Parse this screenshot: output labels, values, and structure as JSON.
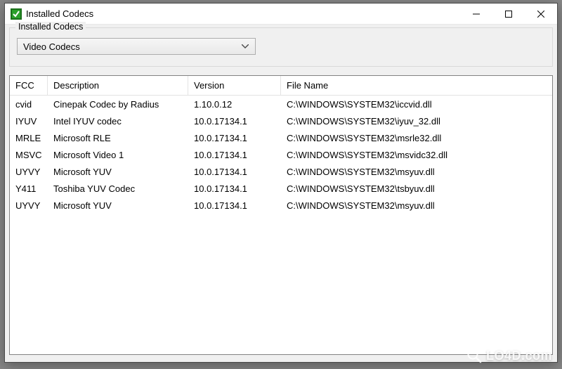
{
  "window": {
    "title": "Installed Codecs"
  },
  "group": {
    "label": "Installed Codecs",
    "dropdown_value": "Video Codecs"
  },
  "columns": {
    "fcc": "FCC",
    "description": "Description",
    "version": "Version",
    "filename": "File Name"
  },
  "rows": [
    {
      "fcc": "cvid",
      "desc": "Cinepak Codec by Radius",
      "ver": "1.10.0.12",
      "file": "C:\\WINDOWS\\SYSTEM32\\iccvid.dll"
    },
    {
      "fcc": "IYUV",
      "desc": "Intel IYUV codec",
      "ver": "10.0.17134.1",
      "file": "C:\\WINDOWS\\SYSTEM32\\iyuv_32.dll"
    },
    {
      "fcc": "MRLE",
      "desc": "Microsoft RLE",
      "ver": "10.0.17134.1",
      "file": "C:\\WINDOWS\\SYSTEM32\\msrle32.dll"
    },
    {
      "fcc": "MSVC",
      "desc": "Microsoft Video 1",
      "ver": "10.0.17134.1",
      "file": "C:\\WINDOWS\\SYSTEM32\\msvidc32.dll"
    },
    {
      "fcc": "UYVY",
      "desc": "Microsoft YUV",
      "ver": "10.0.17134.1",
      "file": "C:\\WINDOWS\\SYSTEM32\\msyuv.dll"
    },
    {
      "fcc": "Y411",
      "desc": "Toshiba YUV Codec",
      "ver": "10.0.17134.1",
      "file": "C:\\WINDOWS\\SYSTEM32\\tsbyuv.dll"
    },
    {
      "fcc": "UYVY",
      "desc": "Microsoft YUV",
      "ver": "10.0.17134.1",
      "file": "C:\\WINDOWS\\SYSTEM32\\msyuv.dll"
    }
  ],
  "watermark": {
    "text": "LO4D.com"
  }
}
